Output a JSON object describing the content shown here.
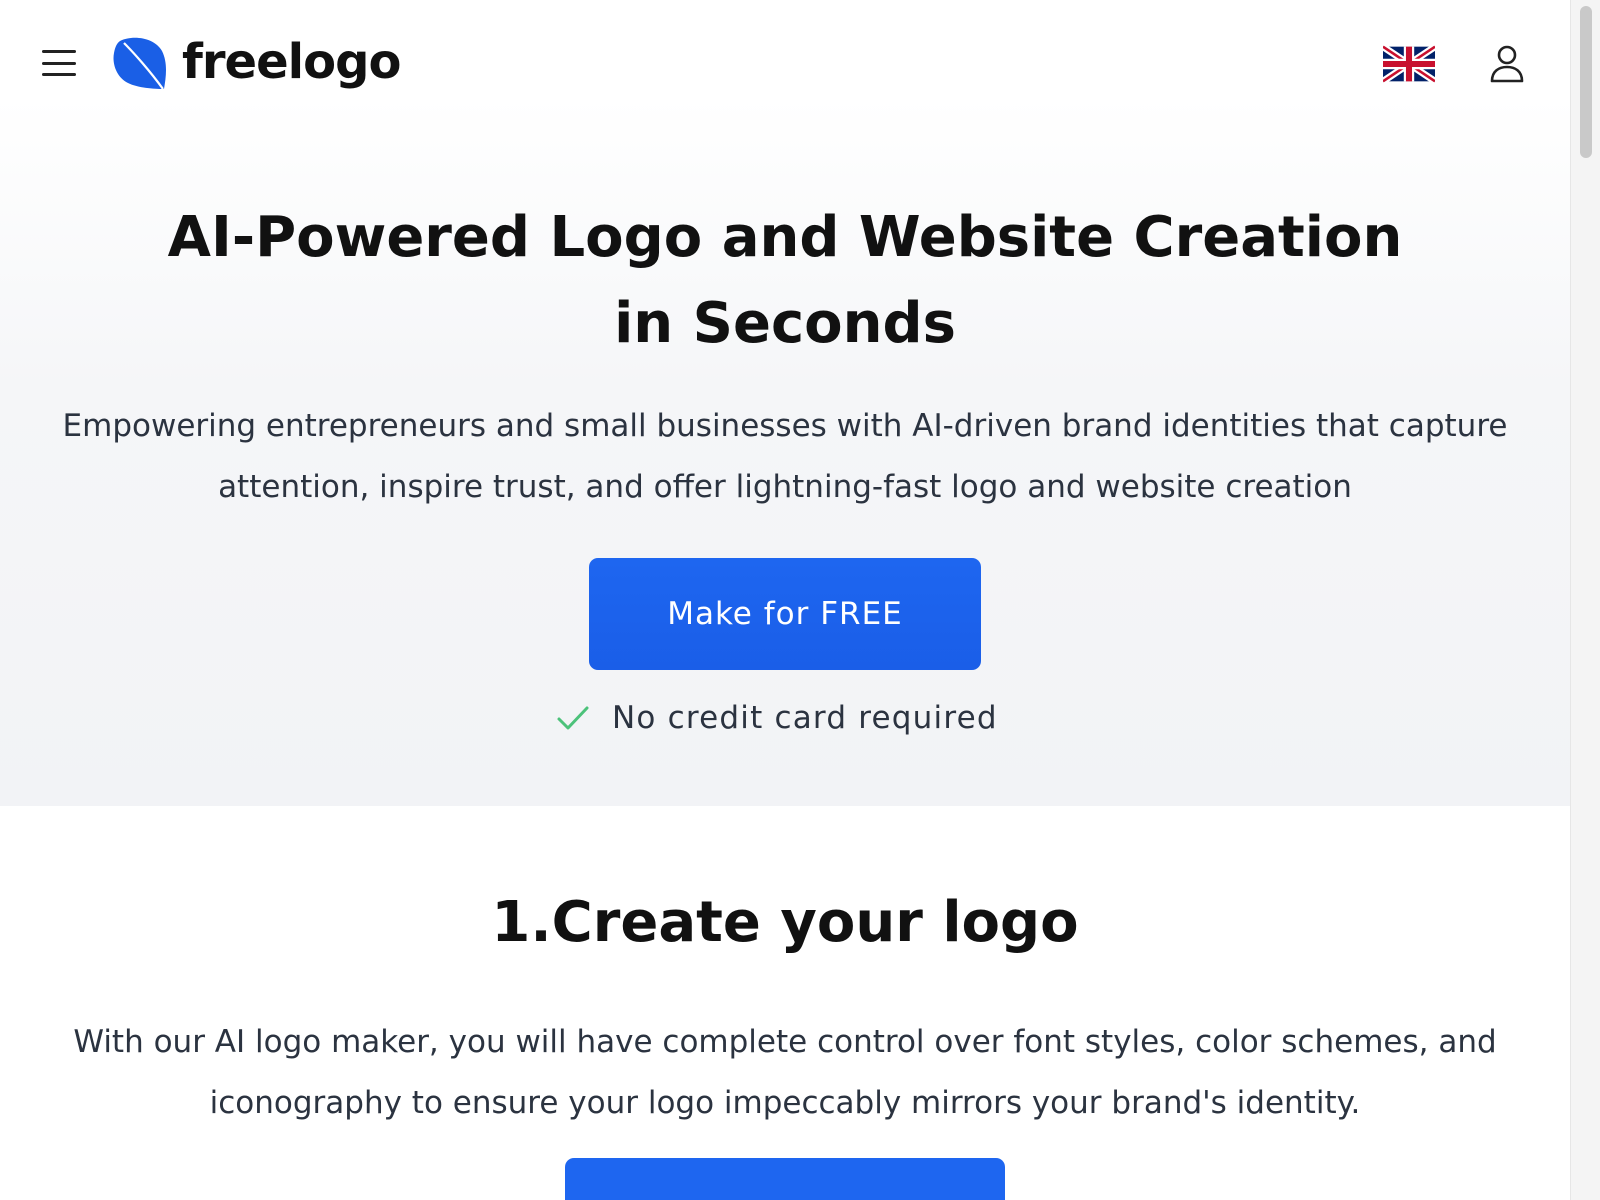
{
  "header": {
    "brand_name": "freelogo",
    "menu_icon": "hamburger-menu-icon",
    "language_icon": "uk-flag-icon",
    "account_icon": "user-icon"
  },
  "hero": {
    "title": "AI-Powered Logo and Website Creation in Seconds",
    "subtitle": "Empowering entrepreneurs and small businesses with AI-driven brand identities that capture attention, inspire trust, and offer lightning-fast logo and website creation",
    "cta_label": "Make for FREE",
    "note": "No credit card required"
  },
  "step1": {
    "title": "1.Create your logo",
    "description": "With our AI logo maker, you will have complete control over font styles, color schemes, and iconography to ensure your logo impeccably mirrors your brand's identity."
  },
  "colors": {
    "accent": "#1e66f0",
    "check": "#4cc27a",
    "text": "#111111",
    "muted_text": "#2b3340"
  }
}
